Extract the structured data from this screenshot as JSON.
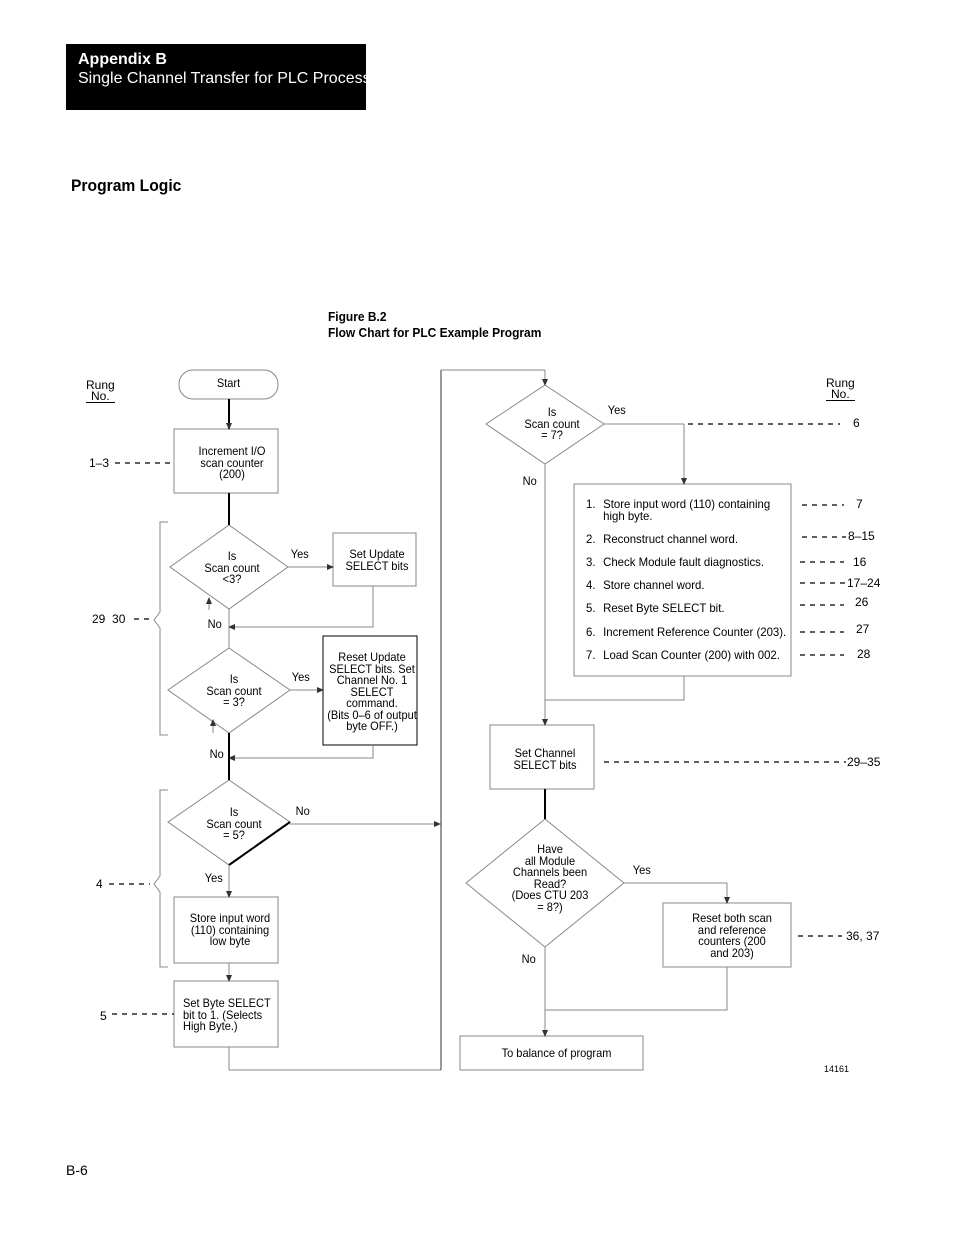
{
  "header": {
    "appendix": "Appendix B",
    "subtitle": "Single Channel Transfer for PLC Processo"
  },
  "section_title": "Program Logic",
  "figure": {
    "number": "Figure B.2",
    "title": "Flow Chart for PLC Example Program",
    "id": "14161"
  },
  "rung_header": {
    "line1": "Rung",
    "line2": "No."
  },
  "nodes": {
    "start": "Start",
    "increment": [
      "Increment I/O",
      "scan counter",
      "(200)"
    ],
    "dec_lt3": [
      "Is",
      "Scan count",
      "<3?"
    ],
    "set_update": [
      "Set Update",
      "SELECT bits"
    ],
    "dec_eq3": [
      "Is",
      "Scan count",
      "= 3?"
    ],
    "reset_update": [
      "Reset Update",
      "SELECT bits. Set",
      "Channel No. 1",
      "SELECT",
      "command.",
      "(Bits 0–6 of output",
      "byte OFF.)"
    ],
    "dec_eq5": [
      "Is",
      "Scan count",
      "= 5?"
    ],
    "store_low": [
      "Store input word",
      "(110) containing",
      "low byte"
    ],
    "set_byte": [
      "Set Byte SELECT",
      "bit to 1. (Selects",
      "High Byte.)"
    ],
    "dec_eq7": [
      "Is",
      "Scan count",
      "= 7?"
    ],
    "set_channel": [
      "Set Channel",
      "SELECT bits"
    ],
    "dec_all": [
      "Have",
      "all Module",
      "Channels been",
      "Read?",
      "(Does CTU 203",
      "= 8?)"
    ],
    "reset_both": [
      "Reset both scan",
      "and reference",
      "counters (200",
      "and 203)"
    ],
    "balance": "To balance of program"
  },
  "branch_labels": {
    "yes": "Yes",
    "no": "No"
  },
  "steps_list": [
    {
      "num": "1.",
      "text": [
        "Store input word (110) containing",
        "high byte."
      ],
      "rung": "7"
    },
    {
      "num": "2.",
      "text": [
        "Reconstruct channel word."
      ],
      "rung": "8–15"
    },
    {
      "num": "3.",
      "text": [
        "Check Module fault diagnostics."
      ],
      "rung": "16"
    },
    {
      "num": "4.",
      "text": [
        "Store channel word."
      ],
      "rung": "17–24"
    },
    {
      "num": "5.",
      "text": [
        "Reset Byte SELECT bit."
      ],
      "rung": "26"
    },
    {
      "num": "6.",
      "text": [
        "Increment Reference Counter (203)."
      ],
      "rung": "27"
    },
    {
      "num": "7.",
      "text": [
        "Load Scan Counter (200) with 002."
      ],
      "rung": "28"
    }
  ],
  "rungs": {
    "increment": "1–3",
    "group_lt3_eq3": "29  30",
    "group_eq5": "4",
    "set_byte": "5",
    "dec_eq7": "6",
    "set_channel": "29–35",
    "reset_both": "36, 37"
  },
  "page_number": "B-6"
}
